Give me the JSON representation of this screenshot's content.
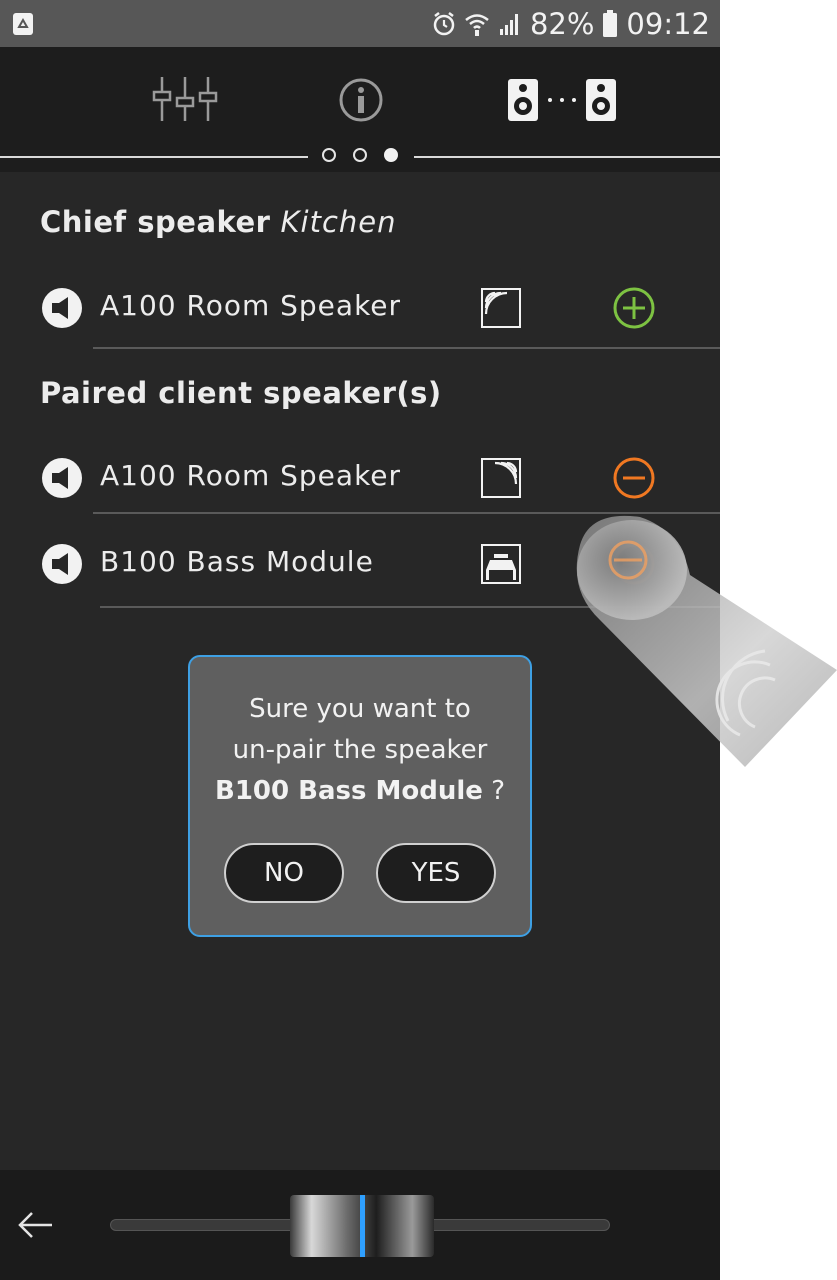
{
  "status_bar": {
    "battery_percent": "82%",
    "time": "09:12",
    "icons": [
      "recycle-icon",
      "alarm-icon",
      "wifi-icon",
      "signal-icon",
      "battery-icon"
    ]
  },
  "toolbar": {
    "icons": [
      "equalizer-sliders-icon",
      "info-icon",
      "speaker-pair-icon"
    ],
    "page_indicator": {
      "pages": 3,
      "active": 3
    }
  },
  "chief": {
    "heading": "Chief speaker",
    "location": "Kitchen",
    "speaker": {
      "name": "A100 Room Speaker",
      "icon": "room-corner-icon",
      "action": "add-icon"
    }
  },
  "paired": {
    "heading": "Paired client speaker(s)",
    "speakers": [
      {
        "name": "A100 Room Speaker",
        "icon": "room-corner-icon",
        "action": "remove-icon"
      },
      {
        "name": "B100 Bass Module",
        "icon": "bass-module-icon",
        "action": "remove-icon"
      }
    ]
  },
  "dialog": {
    "line1": "Sure you want to",
    "line2": "un-pair the speaker",
    "speaker_name": "B100 Bass Module",
    "question_mark": "?",
    "no_label": "NO",
    "yes_label": "YES"
  },
  "bottom_bar": {
    "slider_position": 0.5
  },
  "colors": {
    "add": "#7dc242",
    "remove": "#f07822",
    "dialog_border": "#3ea0e4",
    "slider_accent": "#2fa0ff"
  }
}
